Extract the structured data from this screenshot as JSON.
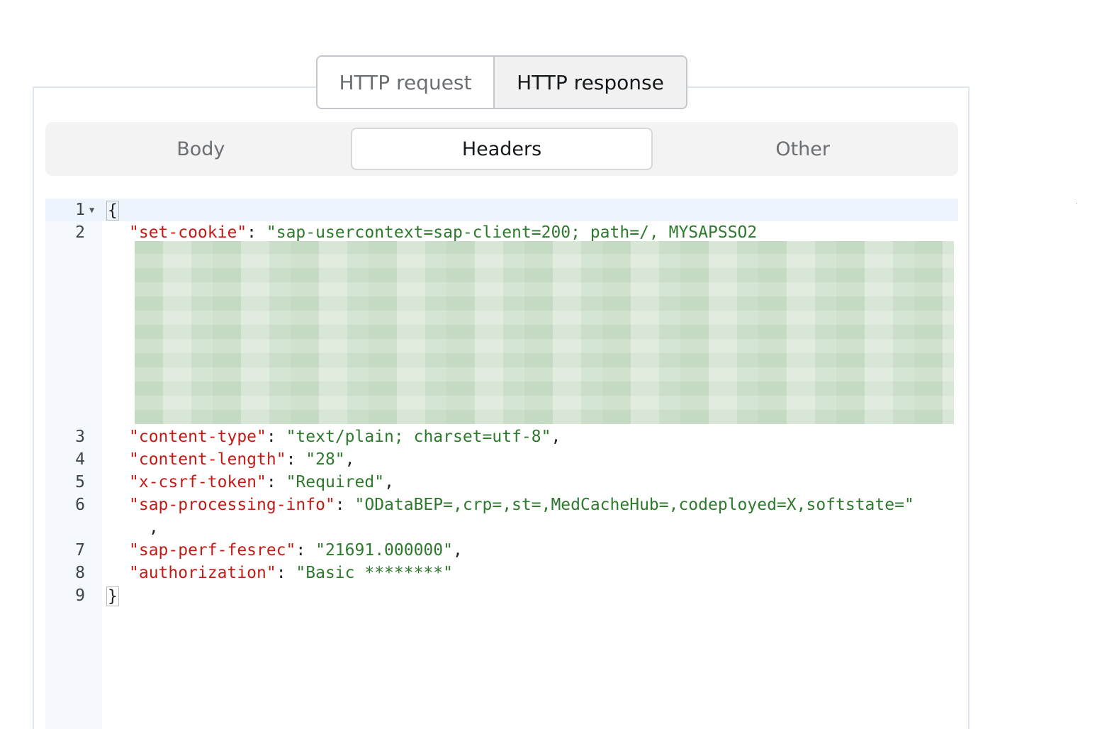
{
  "mode_switch": {
    "request_label": "HTTP request",
    "response_label": "HTTP response",
    "selected": "HTTP response"
  },
  "tabs": {
    "items": [
      {
        "label": "Body"
      },
      {
        "label": "Headers"
      },
      {
        "label": "Other"
      }
    ],
    "selected": "Headers"
  },
  "editor": {
    "lines": [
      {
        "num": "1",
        "open": "{"
      },
      {
        "num": "2",
        "key": "\"set-cookie\"",
        "value": "\"sap-usercontext=sap-client=200; path=/, MYSAPSSO2"
      },
      {
        "num": "3",
        "key": "\"content-type\"",
        "value": "\"text/plain; charset=utf-8\""
      },
      {
        "num": "4",
        "key": "\"content-length\"",
        "value": "\"28\""
      },
      {
        "num": "5",
        "key": "\"x-csrf-token\"",
        "value": "\"Required\""
      },
      {
        "num": "6",
        "key": "\"sap-processing-info\"",
        "value": "\"ODataBEP=,crp=,st=,MedCacheHub=,codeployed=X,softstate=\""
      },
      {
        "num": "7",
        "key": "\"sap-perf-fesrec\"",
        "value": "\"21691.000000\""
      },
      {
        "num": "8",
        "key": "\"authorization\"",
        "value": "\"Basic ********\""
      },
      {
        "num": "9",
        "close": "}"
      }
    ],
    "colon": ": ",
    "comma": ","
  },
  "colors": {
    "key": "#c41a16",
    "string": "#2d7a2d",
    "gutter_bg": "#f5f8fc",
    "active_line_bg": "#edf4fb"
  }
}
